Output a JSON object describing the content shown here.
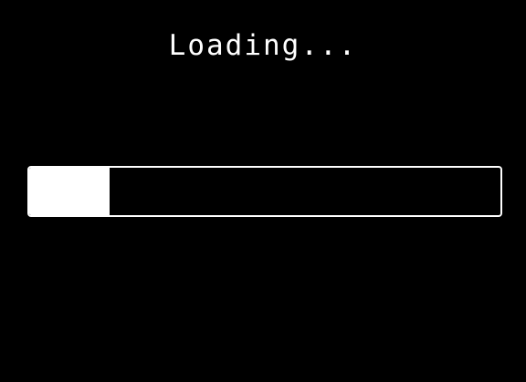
{
  "loading": {
    "label": "Loading..."
  },
  "progress": {
    "fraction": 0.17
  },
  "colors": {
    "background": "#000000",
    "foreground": "#ffffff"
  }
}
